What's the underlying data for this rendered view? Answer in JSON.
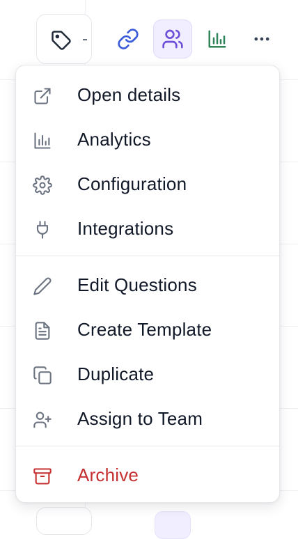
{
  "toolbar": {
    "buttons": [
      {
        "name": "tag-icon"
      },
      {
        "name": "link-icon",
        "color": "#3b5bdb"
      },
      {
        "name": "users-icon",
        "color": "#6d4fd8",
        "active": true
      },
      {
        "name": "bar-chart-icon",
        "color": "#2f855a"
      },
      {
        "name": "more-horizontal-icon",
        "color": "#374151"
      }
    ]
  },
  "menu": {
    "items": [
      {
        "label": "Open details",
        "icon": "external-link-icon"
      },
      {
        "label": "Analytics",
        "icon": "bar-chart-icon"
      },
      {
        "label": "Configuration",
        "icon": "gear-icon"
      },
      {
        "label": "Integrations",
        "icon": "plug-icon"
      },
      {
        "label": "Edit Questions",
        "icon": "pencil-icon"
      },
      {
        "label": "Create Template",
        "icon": "document-icon"
      },
      {
        "label": "Duplicate",
        "icon": "copy-icon"
      },
      {
        "label": "Assign to Team",
        "icon": "user-plus-icon"
      },
      {
        "label": "Archive",
        "icon": "archive-icon",
        "color": "#c53030"
      }
    ]
  }
}
